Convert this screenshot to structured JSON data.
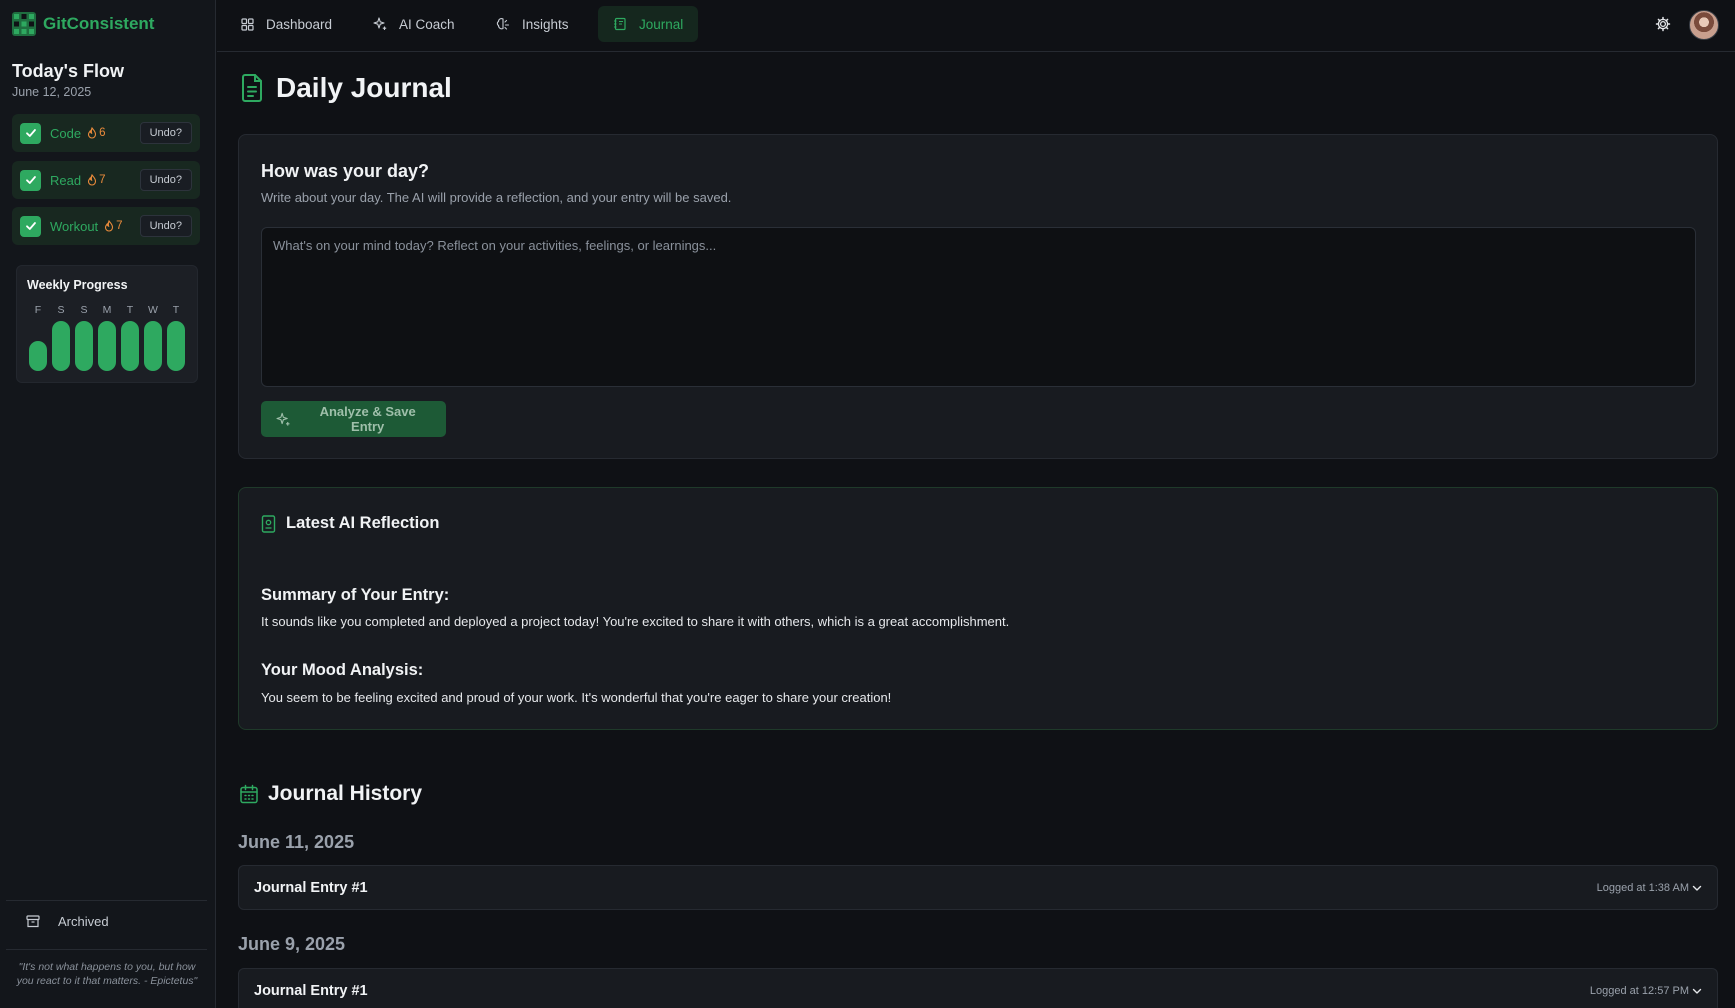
{
  "app": {
    "name": "GitConsistent"
  },
  "sidebar": {
    "title": "Today's Flow",
    "date": "June 12, 2025",
    "habits": [
      {
        "name": "Code",
        "streak": "6",
        "undo": "Undo?"
      },
      {
        "name": "Read",
        "streak": "7",
        "undo": "Undo?"
      },
      {
        "name": "Workout",
        "streak": "7",
        "undo": "Undo?"
      }
    ],
    "weekly": {
      "title": "Weekly Progress",
      "days": [
        "F",
        "S",
        "S",
        "M",
        "T",
        "W",
        "T"
      ],
      "progress": [
        0.6,
        1,
        1,
        1,
        1,
        1,
        1
      ]
    },
    "archived": "Archived",
    "quote": "\"It's not what happens to you, but how you react to it that matters. - Epictetus\""
  },
  "nav": {
    "tabs": [
      {
        "label": "Dashboard",
        "icon": "grid-icon"
      },
      {
        "label": "AI Coach",
        "icon": "sparkles-icon"
      },
      {
        "label": "Insights",
        "icon": "brain-icon"
      },
      {
        "label": "Journal",
        "icon": "notebook-icon"
      }
    ],
    "active_tab": "Journal"
  },
  "main": {
    "title": "Daily Journal",
    "journal": {
      "heading": "How was your day?",
      "subtitle": "Write about your day. The AI will provide a reflection, and your entry will be saved.",
      "value": "",
      "placeholder": "What's on your mind today? Reflect on your activities, feelings, or learnings...",
      "button": "Analyze & Save Entry"
    },
    "reflection": {
      "title": "Latest AI Reflection",
      "summary_heading": "Summary of Your Entry:",
      "summary_text": "It sounds like you completed and deployed a project today! You're excited to share it with others, which is a great accomplishment.",
      "mood_heading": "Your Mood Analysis:",
      "mood_text": "You seem to be feeling excited and proud of your work. It's wonderful that you're eager to share your creation!"
    },
    "history": {
      "title": "Journal History",
      "groups": [
        {
          "date": "June 11, 2025",
          "entries": [
            {
              "title": "Journal Entry #1",
              "time": "Logged at 1:38 AM"
            }
          ]
        },
        {
          "date": "June 9, 2025",
          "entries": [
            {
              "title": "Journal Entry #1",
              "time": "Logged at 12:57 PM"
            }
          ]
        }
      ]
    }
  },
  "colors": {
    "accent": "#2ea960",
    "streak": "#ea8b3b",
    "background": "#0f1115",
    "card": "#181b20"
  }
}
